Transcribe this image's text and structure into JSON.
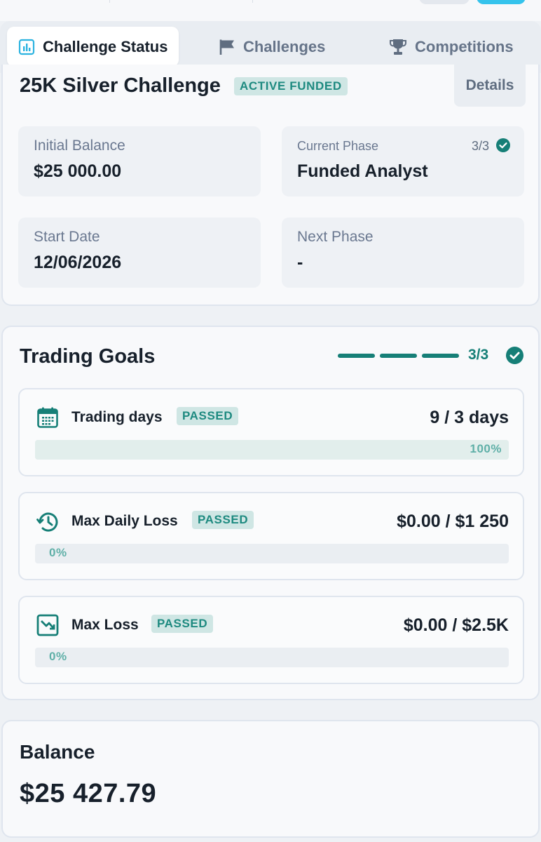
{
  "colors": {
    "accent": "#35c3ec",
    "success": "#167f77",
    "badge_bg": "#cfe6e4",
    "badge_text": "#1e8a80"
  },
  "tabs": [
    {
      "label": "Challenge Status",
      "icon": "bar-chart-icon",
      "active": true
    },
    {
      "label": "Challenges",
      "icon": "flag-icon",
      "active": false
    },
    {
      "label": "Competitions",
      "icon": "trophy-icon",
      "active": false
    }
  ],
  "challenge": {
    "title": "25K Silver Challenge",
    "status_badge": "ACTIVE FUNDED",
    "details_label": "Details",
    "initial_balance": {
      "label": "Initial Balance",
      "value": "$25 000.00"
    },
    "current_phase": {
      "label": "Current Phase",
      "value": "Funded Analyst",
      "count": "3/3",
      "icon": "check-circle-icon"
    },
    "start_date": {
      "label": "Start Date",
      "value": "12/06/2026"
    },
    "next_phase": {
      "label": "Next Phase",
      "value": "-"
    }
  },
  "trading_goals": {
    "title": "Trading Goals",
    "completed_segments": 3,
    "total_segments": 3,
    "count": "3/3",
    "items": [
      {
        "name": "Trading days",
        "icon": "calendar-icon",
        "status": "PASSED",
        "value": "9 / 3 days",
        "progress_label": "100%",
        "progress": 1.0
      },
      {
        "name": "Max Daily Loss",
        "icon": "clock-history-icon",
        "status": "PASSED",
        "value": "$0.00 / $1 250",
        "progress_label": "0%",
        "progress": 0.0
      },
      {
        "name": "Max Loss",
        "icon": "trend-down-icon",
        "status": "PASSED",
        "value": "$0.00 / $2.5K",
        "progress_label": "0%",
        "progress": 0.0
      }
    ]
  },
  "balance": {
    "label": "Balance",
    "value": "$25 427.79"
  }
}
